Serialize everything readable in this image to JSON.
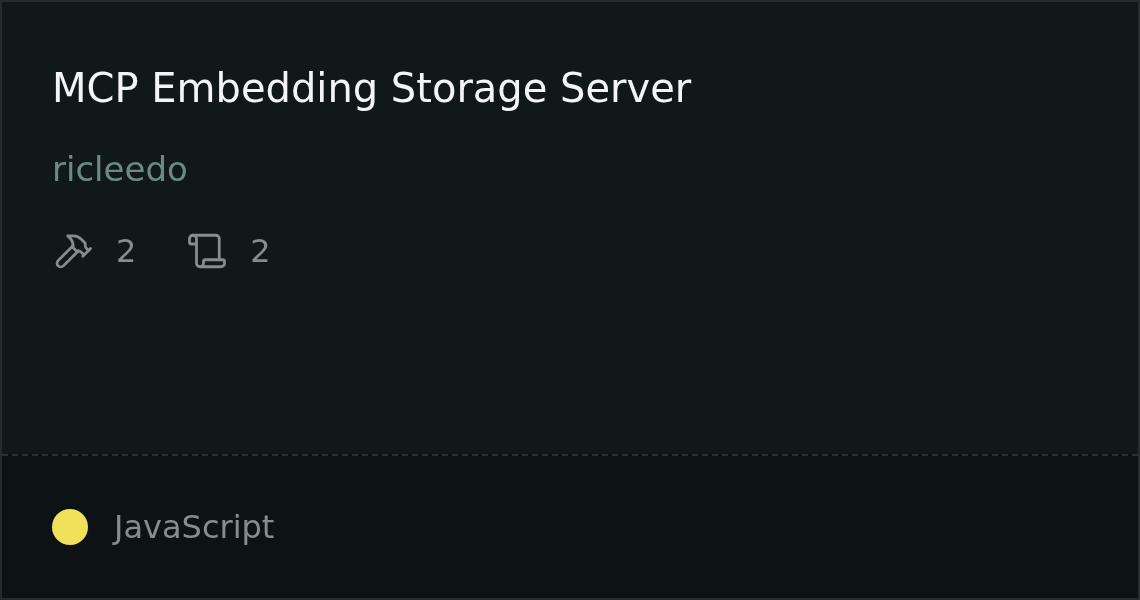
{
  "title": "MCP Embedding Storage Server",
  "author": "ricleedo",
  "stats": [
    {
      "kind": "tools",
      "count": "2"
    },
    {
      "kind": "resources",
      "count": "2"
    }
  ],
  "language": {
    "name": "JavaScript",
    "color": "#f1e05a"
  }
}
